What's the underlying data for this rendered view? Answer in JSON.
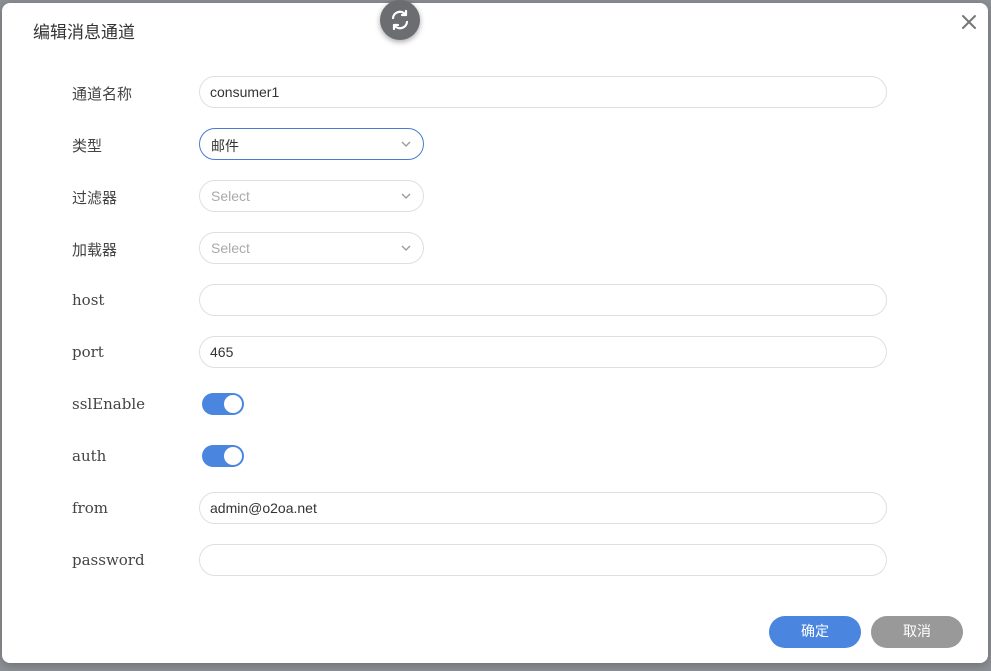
{
  "dialog": {
    "title": "编辑消息通道",
    "close_icon": "close-icon",
    "refresh_icon": "refresh-icon"
  },
  "form": {
    "name": {
      "label": "通道名称",
      "value": "consumer1"
    },
    "type": {
      "label": "类型",
      "value": "邮件"
    },
    "filter": {
      "label": "过滤器",
      "placeholder": "Select"
    },
    "loader": {
      "label": "加载器",
      "placeholder": "Select"
    },
    "host": {
      "label": "host",
      "value": ""
    },
    "port": {
      "label": "port",
      "value": "465"
    },
    "sslEnable": {
      "label": "sslEnable",
      "on": true
    },
    "auth": {
      "label": "auth",
      "on": true
    },
    "from": {
      "label": "from",
      "value": "admin@o2oa.net"
    },
    "password": {
      "label": "password",
      "value": ""
    }
  },
  "buttons": {
    "ok": "确定",
    "cancel": "取消"
  },
  "colors": {
    "accent": "#4a86e0",
    "cancel": "#999999",
    "backdrop": "#8f9296"
  }
}
